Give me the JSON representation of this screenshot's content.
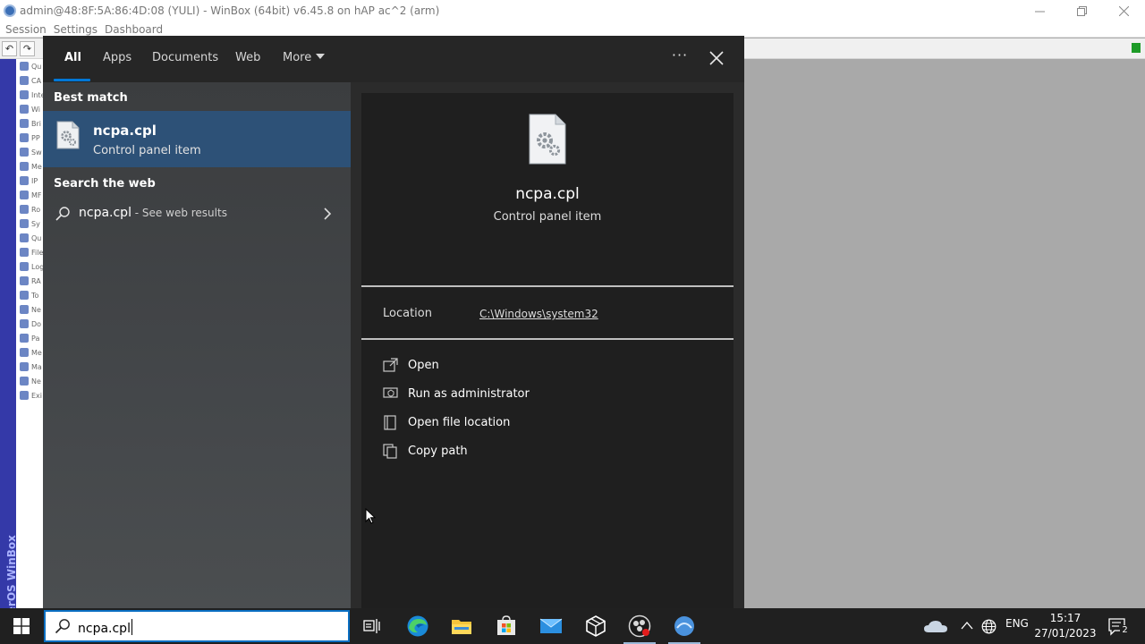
{
  "winbox": {
    "title": "admin@48:8F:5A:86:4D:08 (YULI) - WinBox (64bit) v6.45.8 on hAP ac^2 (arm)",
    "menu": [
      "Session",
      "Settings",
      "Dashboard"
    ],
    "vertical_label": "RouterOS WinBox",
    "nav_items": [
      "Qu",
      "CA",
      "Inte",
      "Wi",
      "Bri",
      "PP",
      "Sw",
      "Me",
      "IP",
      "MF",
      "Ro",
      "Sy",
      "Qu",
      "File",
      "Log",
      "RA",
      "To",
      "Ne",
      "Do",
      "Pa",
      "Me",
      "Ma",
      "Ne",
      "Exi"
    ],
    "colors": {
      "status": "#1d9b27",
      "stripe": "#3439a8"
    }
  },
  "search": {
    "tabs": [
      {
        "label": "All",
        "active": true
      },
      {
        "label": "Apps",
        "active": false
      },
      {
        "label": "Documents",
        "active": false
      },
      {
        "label": "Web",
        "active": false
      },
      {
        "label": "More",
        "active": false
      }
    ],
    "ellipsis": "···",
    "best_match_heading": "Best match",
    "best_match": {
      "title": "ncpa.cpl",
      "subtitle": "Control panel item",
      "icon": "settings-file-icon"
    },
    "web_heading": "Search the web",
    "web_result": {
      "query": "ncpa.cpl",
      "suffix": " - See web results"
    },
    "preview": {
      "title": "ncpa.cpl",
      "subtitle": "Control panel item",
      "location_label": "Location",
      "location_value": "C:\\Windows\\system32",
      "actions": [
        {
          "label": "Open",
          "icon": "open-icon"
        },
        {
          "label": "Run as administrator",
          "icon": "shield-icon"
        },
        {
          "label": "Open file location",
          "icon": "file-location-icon"
        },
        {
          "label": "Copy path",
          "icon": "copy-icon"
        }
      ]
    },
    "accent_color": "#0078d7"
  },
  "taskbar": {
    "search_value": "ncpa.cpl",
    "language": "ENG",
    "time": "15:17",
    "date": "27/01/2023",
    "notification_count": "2",
    "apps": [
      "task-view-icon",
      "edge-icon",
      "file-explorer-icon",
      "store-icon",
      "mail-icon",
      "cube-app-icon",
      "obs-icon",
      "winbox-icon"
    ]
  }
}
